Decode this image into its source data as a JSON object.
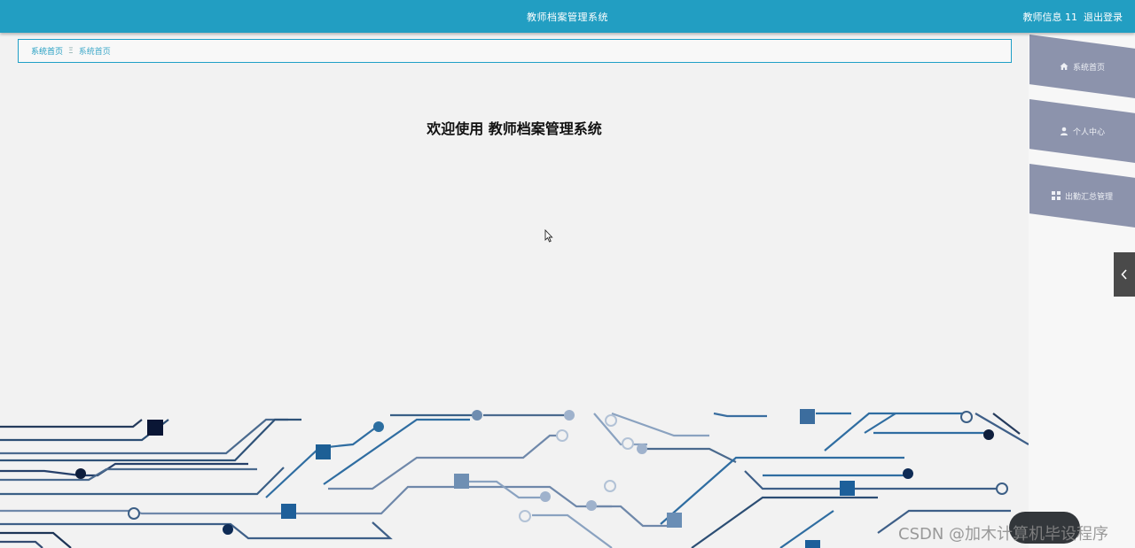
{
  "header": {
    "title": "教师档案管理系统",
    "user_info": "教师信息 11",
    "logout": "退出登录"
  },
  "breadcrumb": {
    "home": "系统首页",
    "separator": "Ξ",
    "current": "系统首页"
  },
  "main": {
    "welcome": "欢迎使用 教师档案管理系统"
  },
  "sidebar": {
    "items": [
      {
        "label": "系统首页",
        "icon": "home-icon"
      },
      {
        "label": "个人中心",
        "icon": "user-icon"
      },
      {
        "label": "出勤汇总管理",
        "icon": "grid-icon"
      }
    ]
  },
  "watermark": "CSDN @加木计算机毕设程序",
  "colors": {
    "header": "#229ec2",
    "sidebar_item": "#8c93ac",
    "background": "#f2f2f2"
  }
}
